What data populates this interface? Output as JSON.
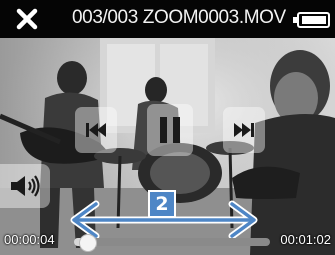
{
  "header": {
    "title": "003/003 ZOOM0003.MOV",
    "close_icon": "close-icon",
    "battery_icon": "battery-icon"
  },
  "controls": {
    "prev_icon": "skip-previous-icon",
    "pause_icon": "pause-icon",
    "next_icon": "skip-next-icon",
    "volume_icon": "volume-icon"
  },
  "annotation": {
    "number": "2",
    "arrow_icon": "double-headed-arrow-icon",
    "color": "#4e86c6"
  },
  "playback": {
    "current_time": "00:00:04",
    "total_time": "00:01:02",
    "progress_fraction": 0.065
  }
}
